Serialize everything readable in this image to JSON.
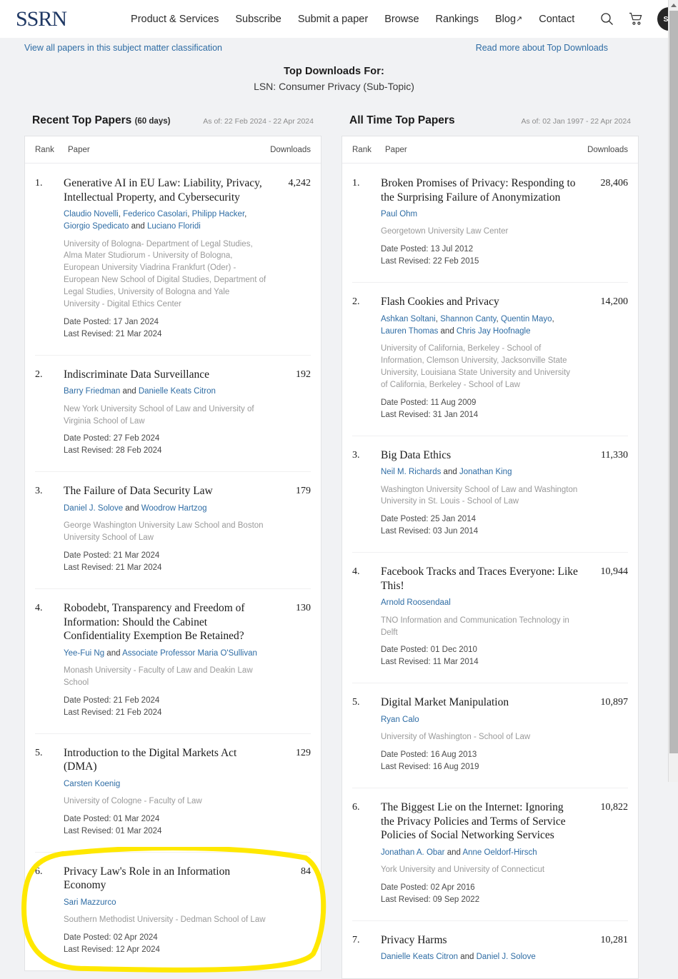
{
  "header": {
    "logo_text": "SSRN",
    "nav": [
      {
        "label": "Product & Services"
      },
      {
        "label": "Subscribe"
      },
      {
        "label": "Submit a paper"
      },
      {
        "label": "Browse"
      },
      {
        "label": "Rankings"
      },
      {
        "label": "Blog",
        "external": "↗"
      },
      {
        "label": "Contact"
      }
    ],
    "search_icon": "search-icon",
    "cart_icon": "shopping-cart-icon",
    "avatar_initials": "SM"
  },
  "sublinks": {
    "left": "View all papers in this subject matter classification",
    "right": "Read more about Top Downloads"
  },
  "page": {
    "title": "Top Downloads For:",
    "subtitle": "LSN: Consumer Privacy (Sub-Topic)"
  },
  "table_headers": {
    "rank": "Rank",
    "paper": "Paper",
    "downloads": "Downloads"
  },
  "recent": {
    "title": "Recent Top Papers",
    "days": "(60 days)",
    "as_of": "As of: 22 Feb 2024 - 22 Apr 2024",
    "rows": [
      {
        "rank": "1.",
        "title": "Generative AI in EU Law: Liability, Privacy, Intellectual Property, and Cybersecurity",
        "authors": [
          {
            "text": "Claudio Novelli",
            "link": true
          },
          {
            "text": ", ",
            "link": false
          },
          {
            "text": "Federico Casolari",
            "link": true
          },
          {
            "text": ", ",
            "link": false
          },
          {
            "text": "Philipp Hacker",
            "link": true
          },
          {
            "text": ", ",
            "link": false
          },
          {
            "text": "Giorgio Spedicato",
            "link": true
          },
          {
            "text": " and ",
            "link": false
          },
          {
            "text": "Luciano Floridi",
            "link": true
          }
        ],
        "affiliation": "University of Bologna- Department of Legal Studies, Alma Mater Studiorum - University of Bologna, European University Viadrina Frankfurt (Oder) - European New School of Digital Studies, Department of Legal Studies, University of Bologna and Yale University - Digital Ethics Center",
        "date_posted": "Date Posted: 17 Jan 2024",
        "last_revised": "Last Revised: 21 Mar 2024",
        "downloads": "4,242"
      },
      {
        "rank": "2.",
        "title": "Indiscriminate Data Surveillance",
        "authors": [
          {
            "text": "Barry Friedman",
            "link": true
          },
          {
            "text": " and ",
            "link": false
          },
          {
            "text": "Danielle Keats Citron",
            "link": true
          }
        ],
        "affiliation": "New York University School of Law and University of Virginia School of Law",
        "date_posted": "Date Posted: 27 Feb 2024",
        "last_revised": "Last Revised: 28 Feb 2024",
        "downloads": "192"
      },
      {
        "rank": "3.",
        "title": "The Failure of Data Security Law",
        "authors": [
          {
            "text": "Daniel J. Solove",
            "link": true
          },
          {
            "text": " and ",
            "link": false
          },
          {
            "text": "Woodrow Hartzog",
            "link": true
          }
        ],
        "affiliation": "George Washington University Law School and Boston University School of Law",
        "date_posted": "Date Posted: 21 Mar 2024",
        "last_revised": "Last Revised: 21 Mar 2024",
        "downloads": "179"
      },
      {
        "rank": "4.",
        "title": "Robodebt, Transparency and Freedom of Information: Should the Cabinet Confidentiality Exemption Be Retained?",
        "authors": [
          {
            "text": "Yee-Fui Ng",
            "link": true
          },
          {
            "text": " and ",
            "link": false
          },
          {
            "text": "Associate Professor Maria O'Sullivan",
            "link": true
          }
        ],
        "affiliation": "Monash University - Faculty of Law and Deakin Law School",
        "date_posted": "Date Posted: 21 Feb 2024",
        "last_revised": "Last Revised: 21 Feb 2024",
        "downloads": "130"
      },
      {
        "rank": "5.",
        "title": "Introduction to the Digital Markets Act (DMA)",
        "authors": [
          {
            "text": "Carsten Koenig",
            "link": true
          }
        ],
        "affiliation": "University of Cologne - Faculty of Law",
        "date_posted": "Date Posted: 01 Mar 2024",
        "last_revised": "Last Revised: 01 Mar 2024",
        "downloads": "129"
      },
      {
        "rank": "6.",
        "title": "Privacy Law's Role in an Information Economy",
        "authors": [
          {
            "text": "Sari Mazzurco",
            "link": true
          }
        ],
        "affiliation": "Southern Methodist University - Dedman School of Law",
        "date_posted": "Date Posted: 02 Apr 2024",
        "last_revised": "Last Revised: 12 Apr 2024",
        "downloads": "84",
        "highlighted": true
      }
    ]
  },
  "all_time": {
    "title": "All Time Top Papers",
    "days": "",
    "as_of": "As of: 02 Jan 1997 - 22 Apr 2024",
    "rows": [
      {
        "rank": "1.",
        "title": "Broken Promises of Privacy: Responding to the Surprising Failure of Anonymization",
        "authors": [
          {
            "text": "Paul Ohm",
            "link": true
          }
        ],
        "affiliation": "Georgetown University Law Center",
        "date_posted": "Date Posted: 13 Jul 2012",
        "last_revised": "Last Revised: 22 Feb 2015",
        "downloads": "28,406"
      },
      {
        "rank": "2.",
        "title": "Flash Cookies and Privacy",
        "authors": [
          {
            "text": "Ashkan Soltani",
            "link": true
          },
          {
            "text": ", ",
            "link": false
          },
          {
            "text": "Shannon Canty",
            "link": true
          },
          {
            "text": ", ",
            "link": false
          },
          {
            "text": "Quentin Mayo",
            "link": true
          },
          {
            "text": ", ",
            "link": false
          },
          {
            "text": "Lauren Thomas",
            "link": true
          },
          {
            "text": " and ",
            "link": false
          },
          {
            "text": "Chris Jay Hoofnagle",
            "link": true
          }
        ],
        "affiliation": "University of California, Berkeley - School of Information, Clemson University, Jacksonville State University, Louisiana State University and University of California, Berkeley - School of Law",
        "date_posted": "Date Posted: 11 Aug 2009",
        "last_revised": "Last Revised: 31 Jan 2014",
        "downloads": "14,200"
      },
      {
        "rank": "3.",
        "title": "Big Data Ethics",
        "authors": [
          {
            "text": "Neil M. Richards",
            "link": true
          },
          {
            "text": " and ",
            "link": false
          },
          {
            "text": "Jonathan King",
            "link": true
          }
        ],
        "affiliation": "Washington University School of Law and Washington University in St. Louis - School of Law",
        "date_posted": "Date Posted: 25 Jan 2014",
        "last_revised": "Last Revised: 03 Jun 2014",
        "downloads": "11,330"
      },
      {
        "rank": "4.",
        "title": "Facebook Tracks and Traces Everyone: Like This!",
        "authors": [
          {
            "text": "Arnold Roosendaal",
            "link": true
          }
        ],
        "affiliation": "TNO Information and Communication Technology in Delft",
        "date_posted": "Date Posted: 01 Dec 2010",
        "last_revised": "Last Revised: 11 Mar 2014",
        "downloads": "10,944"
      },
      {
        "rank": "5.",
        "title": "Digital Market Manipulation",
        "authors": [
          {
            "text": "Ryan Calo",
            "link": true
          }
        ],
        "affiliation": "University of Washington - School of Law",
        "date_posted": "Date Posted: 16 Aug 2013",
        "last_revised": "Last Revised: 16 Aug 2019",
        "downloads": "10,897"
      },
      {
        "rank": "6.",
        "title": "The Biggest Lie on the Internet: Ignoring the Privacy Policies and Terms of Service Policies of Social Networking Services",
        "authors": [
          {
            "text": "Jonathan A. Obar",
            "link": true
          },
          {
            "text": " and ",
            "link": false
          },
          {
            "text": "Anne Oeldorf-Hirsch",
            "link": true
          }
        ],
        "affiliation": "York University and University of Connecticut",
        "date_posted": "Date Posted: 02 Apr 2016",
        "last_revised": "Last Revised: 09 Sep 2022",
        "downloads": "10,822"
      },
      {
        "rank": "7.",
        "title": "Privacy Harms",
        "authors": [
          {
            "text": "Danielle Keats Citron",
            "link": true
          },
          {
            "text": " and ",
            "link": false
          },
          {
            "text": "Daniel J. Solove",
            "link": true
          }
        ],
        "affiliation": "",
        "date_posted": "",
        "last_revised": "",
        "downloads": "10,281"
      }
    ]
  },
  "annotation": {
    "color": "#FFE800",
    "shape": "hand-drawn-ellipse",
    "target": "recent row 6"
  },
  "colors": {
    "logo_navy": "#1f3864",
    "link_blue": "#2e6ca4",
    "page_bg": "#f1f2f4",
    "panel_bg": "#ffffff",
    "affiliation_gray": "#9a9a9a"
  }
}
